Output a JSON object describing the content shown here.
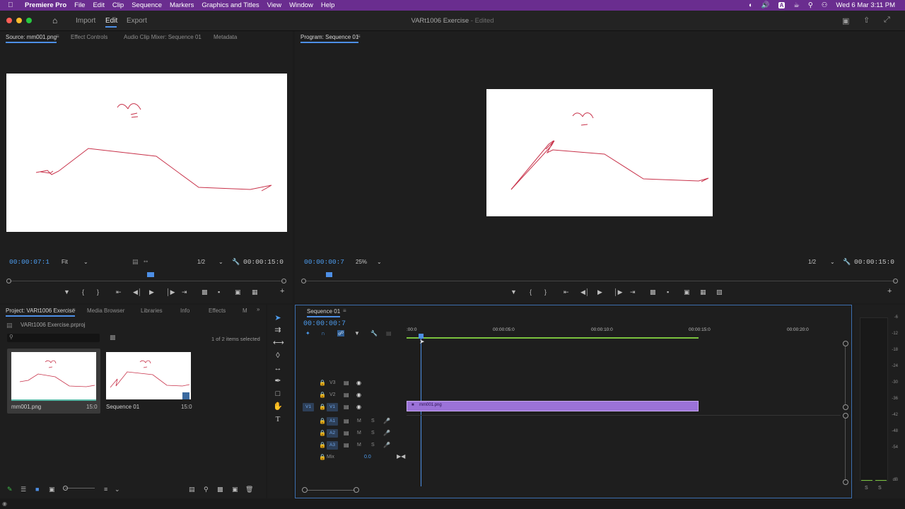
{
  "menubar": {
    "app": "Premiere Pro",
    "items": [
      "File",
      "Edit",
      "Clip",
      "Sequence",
      "Markers",
      "Graphics and Titles",
      "View",
      "Window",
      "Help"
    ],
    "datetime": "Wed 6 Mar  3:11 PM",
    "status_letter": "A"
  },
  "titlebar": {
    "workspaces": [
      "Import",
      "Edit",
      "Export"
    ],
    "active_workspace": "Edit",
    "doc_title": "VARt1006 Exercise",
    "doc_state": "- Edited"
  },
  "source_panel": {
    "tabs": [
      "Source: mm001.png",
      "Effect Controls",
      "Audio Clip Mixer: Sequence 01",
      "Metadata"
    ],
    "timecode": "00:00:07:1",
    "zoom": "Fit",
    "resolution": "1/2",
    "duration": "00:00:15:0"
  },
  "program_panel": {
    "tab": "Program: Sequence 01",
    "timecode": "00:00:00:7",
    "zoom": "25%",
    "resolution": "1/2",
    "duration": "00:00:15:0"
  },
  "project_panel": {
    "tabs": [
      "Project: VARt1006 Exercise",
      "Media Browser",
      "Libraries",
      "Info",
      "Effects",
      "M"
    ],
    "file": "VARt1006 Exercise.prproj",
    "selection_status": "1 of 2 items selected",
    "items": [
      {
        "name": "mm001.png",
        "duration": "15:0"
      },
      {
        "name": "Sequence 01",
        "duration": "15:0"
      }
    ]
  },
  "timeline": {
    "tab": "Sequence 01",
    "timecode": "00:00:00:7",
    "ruler": [
      ":00:0",
      "00:00:05:0",
      "00:00:10:0",
      "00:00:15:0",
      "00:00:20:0"
    ],
    "video_tracks": [
      "V3",
      "V2",
      "V1"
    ],
    "audio_tracks": [
      "A1",
      "A2",
      "A3"
    ],
    "source_patch": "V1",
    "clip_name": "mm001.png",
    "mix_label": "Mix",
    "mix_value": "0.0",
    "mute_label": "M",
    "solo_label": "S"
  },
  "meters": {
    "scale": [
      "-6",
      "-12",
      "-18",
      "-24",
      "-30",
      "-36",
      "-42",
      "-48",
      "-54",
      "dB"
    ],
    "solo_labels": [
      "S",
      "S"
    ]
  },
  "colors": {
    "menubar": "#6a2d8f",
    "accent": "#4d8fe6",
    "clip": "#9b72d8",
    "drawing": "#c8324a"
  }
}
